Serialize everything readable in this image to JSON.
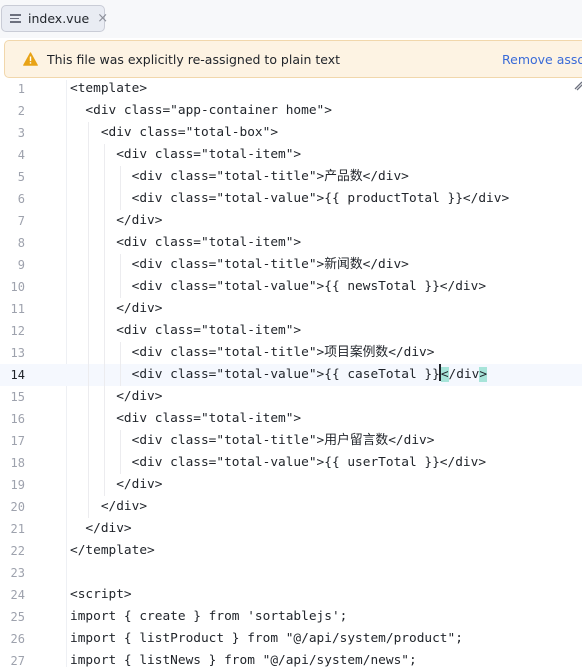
{
  "tab": {
    "label": "index.vue",
    "close": "×",
    "icon": "text-file-icon"
  },
  "banner": {
    "message": "This file was explicitly re-assigned to plain text",
    "action": "Remove assoc",
    "icon": "warning-icon",
    "accent_color": "#e8a317",
    "link_color": "#3a6bd8"
  },
  "editor": {
    "current_line": 14,
    "lines": [
      {
        "n": "1",
        "text": "<template>"
      },
      {
        "n": "2",
        "text": "  <div class=\"app-container home\">"
      },
      {
        "n": "3",
        "text": "    <div class=\"total-box\">"
      },
      {
        "n": "4",
        "text": "      <div class=\"total-item\">"
      },
      {
        "n": "5",
        "text": "        <div class=\"total-title\">产品数</div>"
      },
      {
        "n": "6",
        "text": "        <div class=\"total-value\">{{ productTotal }}</div>"
      },
      {
        "n": "7",
        "text": "      </div>"
      },
      {
        "n": "8",
        "text": "      <div class=\"total-item\">"
      },
      {
        "n": "9",
        "text": "        <div class=\"total-title\">新闻数</div>"
      },
      {
        "n": "10",
        "text": "        <div class=\"total-value\">{{ newsTotal }}</div>"
      },
      {
        "n": "11",
        "text": "      </div>"
      },
      {
        "n": "12",
        "text": "      <div class=\"total-item\">"
      },
      {
        "n": "13",
        "text": "        <div class=\"total-title\">项目案例数</div>"
      },
      {
        "n": "14",
        "text": "        <div class=\"total-value\">{{ caseTotal }}</div>"
      },
      {
        "n": "15",
        "text": "      </div>"
      },
      {
        "n": "16",
        "text": "      <div class=\"total-item\">"
      },
      {
        "n": "17",
        "text": "        <div class=\"total-title\">用户留言数</div>"
      },
      {
        "n": "18",
        "text": "        <div class=\"total-value\">{{ userTotal }}</div>"
      },
      {
        "n": "19",
        "text": "      </div>"
      },
      {
        "n": "20",
        "text": "    </div>"
      },
      {
        "n": "21",
        "text": "  </div>"
      },
      {
        "n": "22",
        "text": "</template>"
      },
      {
        "n": "23",
        "text": ""
      },
      {
        "n": "24",
        "text": "<script>"
      },
      {
        "n": "25",
        "text": "import { create } from 'sortablejs';"
      },
      {
        "n": "26",
        "text": "import { listProduct } from \"@/api/system/product\";"
      },
      {
        "n": "27",
        "text": "import { listNews } from \"@/api/system/news\";"
      }
    ]
  }
}
